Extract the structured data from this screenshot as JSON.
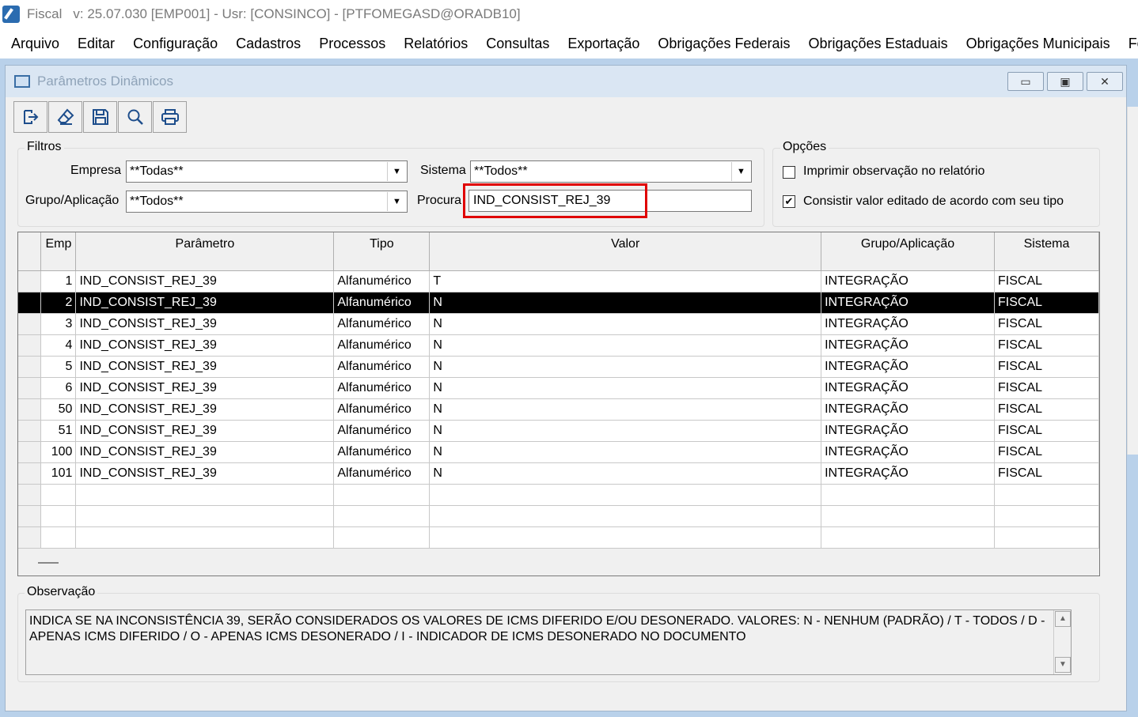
{
  "titlebar": {
    "app_name": "Fiscal",
    "info": "v: 25.07.030   [EMP001] - Usr: [CONSINCO] - [PTFOMEGASD@ORADB10]"
  },
  "menu": [
    "Arquivo",
    "Editar",
    "Configuração",
    "Cadastros",
    "Processos",
    "Relatórios",
    "Consultas",
    "Exportação",
    "Obrigações Federais",
    "Obrigações Estaduais",
    "Obrigações Municipais",
    "Ferra"
  ],
  "window": {
    "title": "Parâmetros Dinâmicos",
    "minimize_glyph": "▭",
    "maximize_glyph": "▣",
    "close_glyph": "✕"
  },
  "toolbar": {
    "icons": [
      "exit-icon",
      "clear-icon",
      "save-icon",
      "search-icon",
      "print-icon"
    ]
  },
  "filtros": {
    "group_label": "Filtros",
    "empresa_label": "Empresa",
    "empresa_value": "**Todas**",
    "sistema_label": "Sistema",
    "sistema_value": "**Todos**",
    "grupo_label": "Grupo/Aplicação",
    "grupo_value": "**Todos**",
    "procura_label": "Procura",
    "procura_value": "IND_CONSIST_REJ_39"
  },
  "opcoes": {
    "group_label": "Opções",
    "imprimir_label": "Imprimir observação no relatório",
    "imprimir_checked": false,
    "consistir_label": "Consistir valor editado de acordo com seu tipo",
    "consistir_checked": true,
    "check_glyph": "✔"
  },
  "grid": {
    "columns": [
      "Emp",
      "Parâmetro",
      "Tipo",
      "Valor",
      "Grupo/Aplicação",
      "Sistema"
    ],
    "rows": [
      {
        "emp": "1",
        "parametro": "IND_CONSIST_REJ_39",
        "tipo": "Alfanumérico",
        "valor": "T",
        "grupo": "INTEGRAÇÃO",
        "sistema": "FISCAL"
      },
      {
        "emp": "2",
        "parametro": "IND_CONSIST_REJ_39",
        "tipo": "Alfanumérico",
        "valor": "N",
        "grupo": "INTEGRAÇÃO",
        "sistema": "FISCAL"
      },
      {
        "emp": "3",
        "parametro": "IND_CONSIST_REJ_39",
        "tipo": "Alfanumérico",
        "valor": "N",
        "grupo": "INTEGRAÇÃO",
        "sistema": "FISCAL"
      },
      {
        "emp": "4",
        "parametro": "IND_CONSIST_REJ_39",
        "tipo": "Alfanumérico",
        "valor": "N",
        "grupo": "INTEGRAÇÃO",
        "sistema": "FISCAL"
      },
      {
        "emp": "5",
        "parametro": "IND_CONSIST_REJ_39",
        "tipo": "Alfanumérico",
        "valor": "N",
        "grupo": "INTEGRAÇÃO",
        "sistema": "FISCAL"
      },
      {
        "emp": "6",
        "parametro": "IND_CONSIST_REJ_39",
        "tipo": "Alfanumérico",
        "valor": "N",
        "grupo": "INTEGRAÇÃO",
        "sistema": "FISCAL"
      },
      {
        "emp": "50",
        "parametro": "IND_CONSIST_REJ_39",
        "tipo": "Alfanumérico",
        "valor": "N",
        "grupo": "INTEGRAÇÃO",
        "sistema": "FISCAL"
      },
      {
        "emp": "51",
        "parametro": "IND_CONSIST_REJ_39",
        "tipo": "Alfanumérico",
        "valor": "N",
        "grupo": "INTEGRAÇÃO",
        "sistema": "FISCAL"
      },
      {
        "emp": "100",
        "parametro": "IND_CONSIST_REJ_39",
        "tipo": "Alfanumérico",
        "valor": "N",
        "grupo": "INTEGRAÇÃO",
        "sistema": "FISCAL"
      },
      {
        "emp": "101",
        "parametro": "IND_CONSIST_REJ_39",
        "tipo": "Alfanumérico",
        "valor": "N",
        "grupo": "INTEGRAÇÃO",
        "sistema": "FISCAL"
      }
    ],
    "selected_row": "2"
  },
  "observacao": {
    "group_label": "Observação",
    "text": "INDICA SE NA INCONSISTÊNCIA 39, SERÃO CONSIDERADOS OS VALORES DE ICMS DIFERIDO E/OU DESONERADO. VALORES: N - NENHUM (PADRÃO) / T - TODOS / D - APENAS ICMS DIFERIDO / O - APENAS ICMS DESONERADO / I - INDICADOR DE ICMS DESONERADO NO DOCUMENTO"
  },
  "colors": {
    "mdi_background": "#b9d1ea",
    "window_title_bg": "#dae6f3",
    "highlight_border": "#e00000",
    "selected_row_bg": "#000000"
  }
}
